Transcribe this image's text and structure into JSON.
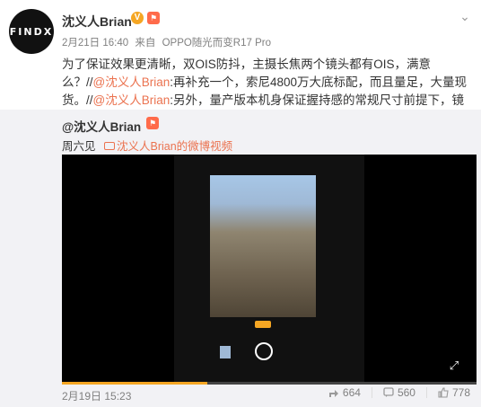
{
  "post": {
    "avatar_text": "FINDX",
    "username": "沈义人Brian",
    "vip_badge": "V",
    "rank_badge": "⚑",
    "meta": {
      "date": "2月21日 16:40",
      "via": "来自",
      "device": "OPPO随光而变R17 Pro"
    },
    "text": {
      "part1": "为了保证效果更清晰，双OIS防抖，主摄长焦两个镜头都有OIS，满意么？//",
      "mention1": "@沈义人Brian",
      "part2": ":再补充一个，索尼4800万大底标配，而且量足，大量现货。//",
      "mention2": "@沈义人Brian",
      "part3": ":另外，量产版本机身保证握持感的常规尺寸前提下，镜头不！凸！起！"
    }
  },
  "repost": {
    "username": "@沈义人Brian",
    "rank_badge": "⚑",
    "time": "周六见",
    "video_link": "沈义人Brian的微博视频"
  },
  "video": {
    "progress_fraction": 0.35
  },
  "footer": {
    "date": "2月19日 15:23",
    "share_count": "664",
    "comment_count": "560",
    "like_count": "778"
  },
  "colors": {
    "mention": "#eb7350",
    "vip": "#f5a623",
    "repost_bg": "#f2f2f5"
  },
  "icons": [
    "chevron-down-icon",
    "vip-badge-icon",
    "rank-badge-icon",
    "video-link-icon",
    "fullscreen-icon",
    "share-icon",
    "comment-icon",
    "like-icon"
  ]
}
